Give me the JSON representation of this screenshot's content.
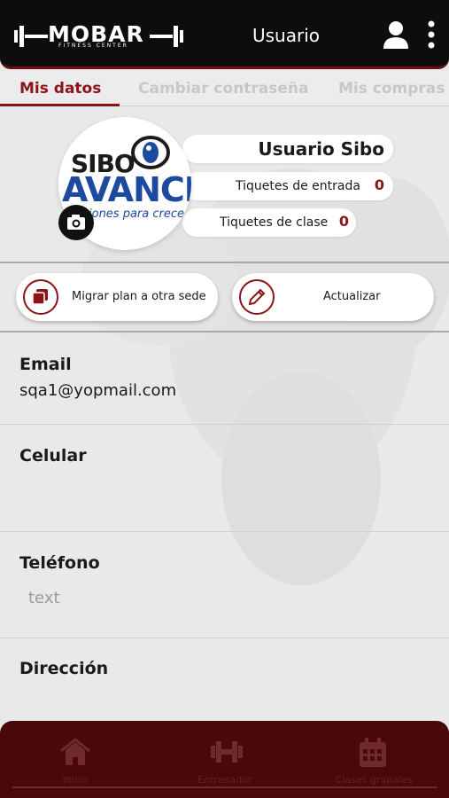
{
  "header": {
    "logo_text": "MOBAR",
    "logo_subtext": "FITNESS CENTER",
    "title": "Usuario",
    "icons": [
      "user-icon",
      "kebab-menu-icon"
    ]
  },
  "tabs": [
    {
      "label": "Mis datos",
      "active": true
    },
    {
      "label": "Cambiar contraseña",
      "active": false
    },
    {
      "label": "Mis compras",
      "active": false
    }
  ],
  "profile": {
    "avatar_logo_line1": "SIBO",
    "avatar_logo_line2": "AVANCE",
    "avatar_logo_line3": "iones para crecer",
    "name": "Usuario Sibo",
    "entry_tickets_label": "Tiquetes de entrada",
    "entry_tickets_value": "0",
    "class_tickets_label": "Tiquetes de clase",
    "class_tickets_value": "0"
  },
  "actions": {
    "migrate_label": "Migrar plan a otra sede",
    "update_label": "Actualizar"
  },
  "fields": {
    "email_label": "Email",
    "email_value": "sqa1@yopmail.com",
    "phone_mobile_label": "Celular",
    "phone_label": "Teléfono",
    "phone_placeholder": "text",
    "address_label": "Dirección"
  },
  "bottom_nav": [
    {
      "label": "Inicio",
      "icon": "home-icon"
    },
    {
      "label": "Entrenador",
      "icon": "dumbbell-icon"
    },
    {
      "label": "Clases grupales",
      "icon": "calendar-icon"
    }
  ],
  "colors": {
    "accent": "#8a1418",
    "header_bg": "#0d0d0d",
    "bottom_nav_bg": "#4a080b"
  }
}
